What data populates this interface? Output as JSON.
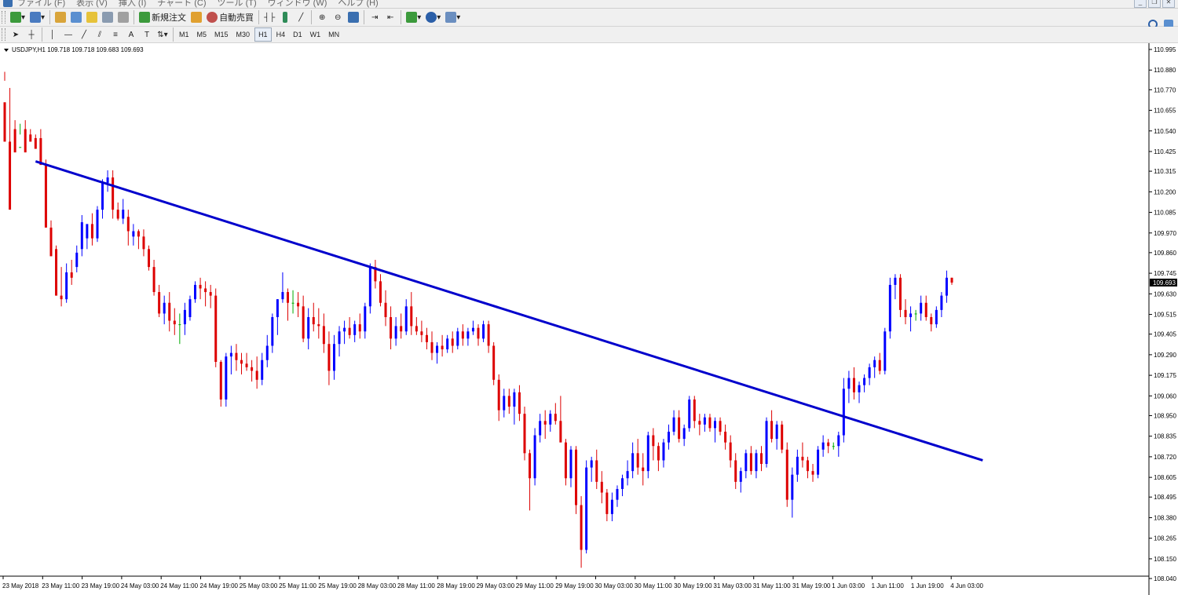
{
  "window": {
    "menus": [
      "ファイル (F)",
      "表示 (V)",
      "挿入 (I)",
      "チャート (C)",
      "ツール (T)",
      "ウィンドウ (W)",
      "ヘルプ (H)"
    ]
  },
  "toolbar": {
    "new_order_label": "新規注文",
    "auto_trade_label": "自動売買",
    "timeframes": [
      "M1",
      "M5",
      "M15",
      "M30",
      "H1",
      "H4",
      "D1",
      "W1",
      "MN"
    ],
    "active_timeframe": "H1",
    "text_tool_label": "A",
    "icons": [
      "new-chart-icon",
      "profiles-icon",
      "market-watch-icon",
      "navigator-icon",
      "favorites-icon",
      "terminal-icon",
      "strategy-tester-icon",
      "new-order-icon",
      "metaeditor-icon",
      "auto-trading-icon",
      "bar-chart-icon",
      "candlestick-icon",
      "line-chart-icon",
      "zoom-in-icon",
      "zoom-out-icon",
      "tile-windows-icon",
      "autoscroll-icon",
      "chart-shift-icon",
      "indicators-icon",
      "periods-icon",
      "templates-icon",
      "cursor-icon",
      "crosshair-icon",
      "vertical-line-icon",
      "horizontal-line-icon",
      "trendline-icon",
      "equidistant-channel-icon",
      "fibonacci-icon",
      "text-icon",
      "text-label-icon",
      "arrows-icon",
      "search-icon",
      "chat-icon"
    ]
  },
  "chart": {
    "header": "USDJPY,H1  109.718 109.718 109.683 109.693",
    "current_price": "109.693",
    "colors": {
      "bull": "#0000ff",
      "bear": "#dd0000",
      "doji": "#00aa00",
      "trendline": "#0000cc",
      "price_tag_bg": "#000000"
    }
  },
  "chart_data": {
    "type": "candlestick",
    "symbol": "USDJPY",
    "timeframe": "H1",
    "yticks": [
      110.995,
      110.88,
      110.77,
      110.655,
      110.54,
      110.425,
      110.315,
      110.2,
      110.085,
      109.97,
      109.86,
      109.745,
      109.63,
      109.515,
      109.405,
      109.29,
      109.175,
      109.06,
      108.95,
      108.835,
      108.72,
      108.605,
      108.495,
      108.38,
      108.265,
      108.15,
      108.04
    ],
    "ylim": [
      108.04,
      110.995
    ],
    "xticks": [
      "23 May 2018",
      "23 May 11:00",
      "23 May 19:00",
      "24 May 03:00",
      "24 May 11:00",
      "24 May 19:00",
      "25 May 03:00",
      "25 May 11:00",
      "25 May 19:00",
      "28 May 03:00",
      "28 May 11:00",
      "28 May 19:00",
      "29 May 03:00",
      "29 May 11:00",
      "29 May 19:00",
      "30 May 03:00",
      "30 May 11:00",
      "30 May 19:00",
      "31 May 03:00",
      "31 May 11:00",
      "31 May 19:00",
      "1 Jun 03:00",
      "1 Jun 11:00",
      "1 Jun 19:00",
      "4 Jun 03:00"
    ],
    "ohlc": [
      [
        110.7,
        110.87,
        110.82,
        110.48
      ],
      [
        110.48,
        110.78,
        110.45,
        110.1
      ],
      [
        110.55,
        110.6,
        110.45,
        110.42
      ],
      [
        110.45,
        110.58,
        110.52,
        110.45
      ],
      [
        110.55,
        110.6,
        110.5,
        110.42
      ],
      [
        110.52,
        110.55,
        110.5,
        110.48
      ],
      [
        110.5,
        110.52,
        110.5,
        110.44
      ],
      [
        110.5,
        110.55,
        110.5,
        110.35
      ],
      [
        110.35,
        110.38,
        110.32,
        110.0
      ],
      [
        110.0,
        110.04,
        109.95,
        109.84
      ],
      [
        109.88,
        109.9,
        109.85,
        109.62
      ],
      [
        109.62,
        109.78,
        109.56,
        109.6
      ],
      [
        109.6,
        109.8,
        109.58,
        109.75
      ],
      [
        109.75,
        109.82,
        109.68,
        109.72
      ],
      [
        109.78,
        109.9,
        109.75,
        109.86
      ],
      [
        109.88,
        110.07,
        109.84,
        110.03
      ],
      [
        109.94,
        110.0,
        109.88,
        110.02
      ],
      [
        110.02,
        110.08,
        109.9,
        109.94
      ],
      [
        109.94,
        110.12,
        109.92,
        110.1
      ],
      [
        110.1,
        110.27,
        110.05,
        110.25
      ],
      [
        110.25,
        110.32,
        110.2,
        110.28
      ],
      [
        110.28,
        110.32,
        110.05,
        110.1
      ],
      [
        110.1,
        110.14,
        110.04,
        110.05
      ],
      [
        110.05,
        110.16,
        110.02,
        110.1
      ],
      [
        110.06,
        110.1,
        109.9,
        109.98
      ],
      [
        109.95,
        110.02,
        109.9,
        109.98
      ],
      [
        109.98,
        109.99,
        109.88,
        109.95
      ],
      [
        109.95,
        109.99,
        109.84,
        109.88
      ],
      [
        109.88,
        109.9,
        109.76,
        109.78
      ],
      [
        109.78,
        109.82,
        109.62,
        109.64
      ],
      [
        109.64,
        109.68,
        109.5,
        109.52
      ],
      [
        109.52,
        109.62,
        109.46,
        109.58
      ],
      [
        109.58,
        109.64,
        109.42,
        109.48
      ],
      [
        109.48,
        109.55,
        109.4,
        109.46
      ],
      [
        109.46,
        109.52,
        109.35,
        109.46
      ],
      [
        109.46,
        109.58,
        109.4,
        109.54
      ],
      [
        109.5,
        109.62,
        109.48,
        109.6
      ],
      [
        109.6,
        109.7,
        109.58,
        109.68
      ],
      [
        109.68,
        109.72,
        109.6,
        109.66
      ],
      [
        109.66,
        109.7,
        109.56,
        109.64
      ],
      [
        109.64,
        109.68,
        109.55,
        109.62
      ],
      [
        109.62,
        109.66,
        109.22,
        109.25
      ],
      [
        109.25,
        109.26,
        109.0,
        109.04
      ],
      [
        109.04,
        109.3,
        109.0,
        109.28
      ],
      [
        109.28,
        109.34,
        109.18,
        109.3
      ],
      [
        109.3,
        109.35,
        109.2,
        109.26
      ],
      [
        109.26,
        109.3,
        109.18,
        109.24
      ],
      [
        109.24,
        109.3,
        109.2,
        109.22
      ],
      [
        109.22,
        109.26,
        109.14,
        109.2
      ],
      [
        109.2,
        109.28,
        109.1,
        109.15
      ],
      [
        109.15,
        109.3,
        109.12,
        109.26
      ],
      [
        109.26,
        109.4,
        109.22,
        109.34
      ],
      [
        109.34,
        109.52,
        109.3,
        109.5
      ],
      [
        109.5,
        109.6,
        109.4,
        109.6
      ],
      [
        109.6,
        109.75,
        109.58,
        109.64
      ],
      [
        109.64,
        109.66,
        109.48,
        109.58
      ],
      [
        109.58,
        109.65,
        109.52,
        109.58
      ],
      [
        109.58,
        109.64,
        109.5,
        109.56
      ],
      [
        109.56,
        109.62,
        109.36,
        109.38
      ],
      [
        109.38,
        109.55,
        109.32,
        109.5
      ],
      [
        109.5,
        109.58,
        109.42,
        109.46
      ],
      [
        109.46,
        109.55,
        109.38,
        109.45
      ],
      [
        109.45,
        109.52,
        109.3,
        109.35
      ],
      [
        109.35,
        109.42,
        109.12,
        109.2
      ],
      [
        109.2,
        109.4,
        109.15,
        109.35
      ],
      [
        109.35,
        109.45,
        109.28,
        109.42
      ],
      [
        109.42,
        109.48,
        109.35,
        109.44
      ],
      [
        109.44,
        109.5,
        109.38,
        109.4
      ],
      [
        109.4,
        109.48,
        109.36,
        109.46
      ],
      [
        109.46,
        109.52,
        109.38,
        109.42
      ],
      [
        109.42,
        109.58,
        109.38,
        109.56
      ],
      [
        109.56,
        109.8,
        109.52,
        109.78
      ],
      [
        109.78,
        109.82,
        109.66,
        109.7
      ],
      [
        109.7,
        109.74,
        109.56,
        109.58
      ],
      [
        109.58,
        109.65,
        109.45,
        109.5
      ],
      [
        109.5,
        109.56,
        109.32,
        109.38
      ],
      [
        109.38,
        109.5,
        109.34,
        109.45
      ],
      [
        109.45,
        109.52,
        109.38,
        109.42
      ],
      [
        109.42,
        109.6,
        109.4,
        109.56
      ],
      [
        109.56,
        109.64,
        109.4,
        109.45
      ],
      [
        109.45,
        109.5,
        109.4,
        109.42
      ],
      [
        109.42,
        109.48,
        109.36,
        109.4
      ],
      [
        109.4,
        109.44,
        109.32,
        109.36
      ],
      [
        109.36,
        109.42,
        109.26,
        109.3
      ],
      [
        109.3,
        109.36,
        109.24,
        109.34
      ],
      [
        109.34,
        109.4,
        109.28,
        109.32
      ],
      [
        109.32,
        109.4,
        109.3,
        109.38
      ],
      [
        109.38,
        109.42,
        109.3,
        109.34
      ],
      [
        109.34,
        109.44,
        109.32,
        109.42
      ],
      [
        109.42,
        109.46,
        109.34,
        109.38
      ],
      [
        109.38,
        109.44,
        109.34,
        109.42
      ],
      [
        109.42,
        109.48,
        109.4,
        109.44
      ],
      [
        109.44,
        109.46,
        109.34,
        109.38
      ],
      [
        109.38,
        109.48,
        109.36,
        109.46
      ],
      [
        109.46,
        109.48,
        109.3,
        109.34
      ],
      [
        109.34,
        109.36,
        109.12,
        109.15
      ],
      [
        109.15,
        109.18,
        108.92,
        108.98
      ],
      [
        108.98,
        109.1,
        108.94,
        109.06
      ],
      [
        109.06,
        109.1,
        108.96,
        109.0
      ],
      [
        109.0,
        109.1,
        108.9,
        109.08
      ],
      [
        109.08,
        109.12,
        108.92,
        108.96
      ],
      [
        108.96,
        109.0,
        108.7,
        108.74
      ],
      [
        108.74,
        108.76,
        108.42,
        108.6
      ],
      [
        108.6,
        108.88,
        108.56,
        108.84
      ],
      [
        108.84,
        108.96,
        108.8,
        108.92
      ],
      [
        108.92,
        108.98,
        108.82,
        108.9
      ],
      [
        108.9,
        108.98,
        108.86,
        108.96
      ],
      [
        108.96,
        109.02,
        108.9,
        108.92
      ],
      [
        108.92,
        109.06,
        108.88,
        108.8
      ],
      [
        108.8,
        108.82,
        108.56,
        108.6
      ],
      [
        108.6,
        108.78,
        108.55,
        108.76
      ],
      [
        108.76,
        108.78,
        108.4,
        108.45
      ],
      [
        108.45,
        108.5,
        108.1,
        108.2
      ],
      [
        108.2,
        108.7,
        108.18,
        108.66
      ],
      [
        108.66,
        108.72,
        108.58,
        108.7
      ],
      [
        108.7,
        108.76,
        108.54,
        108.58
      ],
      [
        108.58,
        108.64,
        108.46,
        108.52
      ],
      [
        108.52,
        108.54,
        108.36,
        108.4
      ],
      [
        108.4,
        108.52,
        108.36,
        108.48
      ],
      [
        108.48,
        108.56,
        108.44,
        108.54
      ],
      [
        108.54,
        108.62,
        108.5,
        108.6
      ],
      [
        108.6,
        108.7,
        108.56,
        108.64
      ],
      [
        108.64,
        108.8,
        108.6,
        108.74
      ],
      [
        108.74,
        108.82,
        108.62,
        108.66
      ],
      [
        108.66,
        108.74,
        108.56,
        108.64
      ],
      [
        108.64,
        108.86,
        108.6,
        108.84
      ],
      [
        108.84,
        108.88,
        108.7,
        108.78
      ],
      [
        108.78,
        108.8,
        108.64,
        108.7
      ],
      [
        108.7,
        108.82,
        108.66,
        108.8
      ],
      [
        108.8,
        108.9,
        108.76,
        108.86
      ],
      [
        108.86,
        108.98,
        108.84,
        108.94
      ],
      [
        108.94,
        108.98,
        108.8,
        108.82
      ],
      [
        108.82,
        108.9,
        108.78,
        108.88
      ],
      [
        108.88,
        109.06,
        108.86,
        109.04
      ],
      [
        109.04,
        109.06,
        108.88,
        108.92
      ],
      [
        108.92,
        108.96,
        108.84,
        108.9
      ],
      [
        108.9,
        108.96,
        108.86,
        108.94
      ],
      [
        108.94,
        108.96,
        108.86,
        108.88
      ],
      [
        108.88,
        108.94,
        108.8,
        108.92
      ],
      [
        108.92,
        108.94,
        108.84,
        108.86
      ],
      [
        108.86,
        108.9,
        108.76,
        108.8
      ],
      [
        108.8,
        108.84,
        108.66,
        108.7
      ],
      [
        108.7,
        108.74,
        108.54,
        108.58
      ],
      [
        108.58,
        108.66,
        108.52,
        108.64
      ],
      [
        108.64,
        108.76,
        108.6,
        108.74
      ],
      [
        108.74,
        108.78,
        108.62,
        108.64
      ],
      [
        108.64,
        108.76,
        108.6,
        108.74
      ],
      [
        108.74,
        108.78,
        108.64,
        108.68
      ],
      [
        108.68,
        108.94,
        108.66,
        108.92
      ],
      [
        108.92,
        108.98,
        108.8,
        108.82
      ],
      [
        108.82,
        108.92,
        108.76,
        108.9
      ],
      [
        108.9,
        108.92,
        108.74,
        108.76
      ],
      [
        108.76,
        108.8,
        108.44,
        108.48
      ],
      [
        108.48,
        108.66,
        108.38,
        108.62
      ],
      [
        108.62,
        108.76,
        108.58,
        108.72
      ],
      [
        108.72,
        108.8,
        108.66,
        108.7
      ],
      [
        108.7,
        108.72,
        108.6,
        108.64
      ],
      [
        108.64,
        108.68,
        108.58,
        108.62
      ],
      [
        108.62,
        108.78,
        108.6,
        108.76
      ],
      [
        108.76,
        108.84,
        108.72,
        108.8
      ],
      [
        108.8,
        108.82,
        108.74,
        108.78
      ],
      [
        108.78,
        108.8,
        108.76,
        108.78
      ],
      [
        108.78,
        108.86,
        108.72,
        108.84
      ],
      [
        108.84,
        109.16,
        108.8,
        109.1
      ],
      [
        109.1,
        109.2,
        109.02,
        109.16
      ],
      [
        109.16,
        109.22,
        109.04,
        109.08
      ],
      [
        109.08,
        109.14,
        109.02,
        109.12
      ],
      [
        109.12,
        109.18,
        109.08,
        109.16
      ],
      [
        109.16,
        109.24,
        109.12,
        109.22
      ],
      [
        109.22,
        109.28,
        109.16,
        109.26
      ],
      [
        109.26,
        109.3,
        109.18,
        109.2
      ],
      [
        109.2,
        109.44,
        109.18,
        109.42
      ],
      [
        109.42,
        109.72,
        109.38,
        109.68
      ],
      [
        109.68,
        109.74,
        109.6,
        109.72
      ],
      [
        109.72,
        109.74,
        109.5,
        109.54
      ],
      [
        109.54,
        109.6,
        109.46,
        109.5
      ],
      [
        109.5,
        109.56,
        109.42,
        109.52
      ],
      [
        109.52,
        109.54,
        109.48,
        109.52
      ],
      [
        109.52,
        109.62,
        109.48,
        109.58
      ],
      [
        109.58,
        109.62,
        109.48,
        109.5
      ],
      [
        109.5,
        109.52,
        109.42,
        109.46
      ],
      [
        109.46,
        109.56,
        109.44,
        109.54
      ],
      [
        109.54,
        109.64,
        109.5,
        109.62
      ],
      [
        109.62,
        109.76,
        109.58,
        109.72
      ],
      [
        109.72,
        109.72,
        109.68,
        109.693
      ]
    ],
    "trendline": {
      "start": {
        "bar": 6,
        "price": 110.37
      },
      "end": {
        "bar": 190,
        "price": 108.7
      }
    },
    "grid": false
  }
}
